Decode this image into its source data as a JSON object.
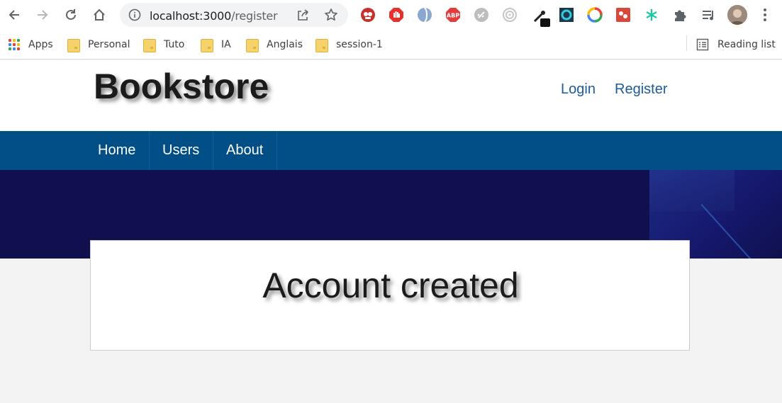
{
  "browser": {
    "url_host": "localhost:3000",
    "url_path": "/register",
    "bookmarks": [
      {
        "label": "Apps",
        "icon": "apps-grid-icon"
      },
      {
        "label": "Personal",
        "icon": "folder-icon"
      },
      {
        "label": "Tuto",
        "icon": "folder-icon"
      },
      {
        "label": "IA",
        "icon": "folder-icon"
      },
      {
        "label": "Anglais",
        "icon": "folder-icon"
      },
      {
        "label": "session-1",
        "icon": "folder-icon"
      }
    ],
    "reading_list_label": "Reading list",
    "extensions": [
      "ublock-icon",
      "adblock-hand-icon",
      "sphere-icon",
      "abp-icon",
      "gray-link-icon",
      "target-icon",
      "eyedropper-icon",
      "cyan-square-icon",
      "colorful-ring-icon",
      "red-extension-icon",
      "teal-asterisk-icon",
      "puzzle-icon",
      "media-queue-icon"
    ]
  },
  "site": {
    "title": "Bookstore",
    "auth_links": {
      "login": "Login",
      "register": "Register"
    },
    "nav": [
      "Home",
      "Users",
      "About"
    ],
    "colors": {
      "nav_bg": "#024e86",
      "hero_bg": "#10104e",
      "link": "#1e5b9a"
    }
  },
  "main": {
    "message": "Account created"
  }
}
